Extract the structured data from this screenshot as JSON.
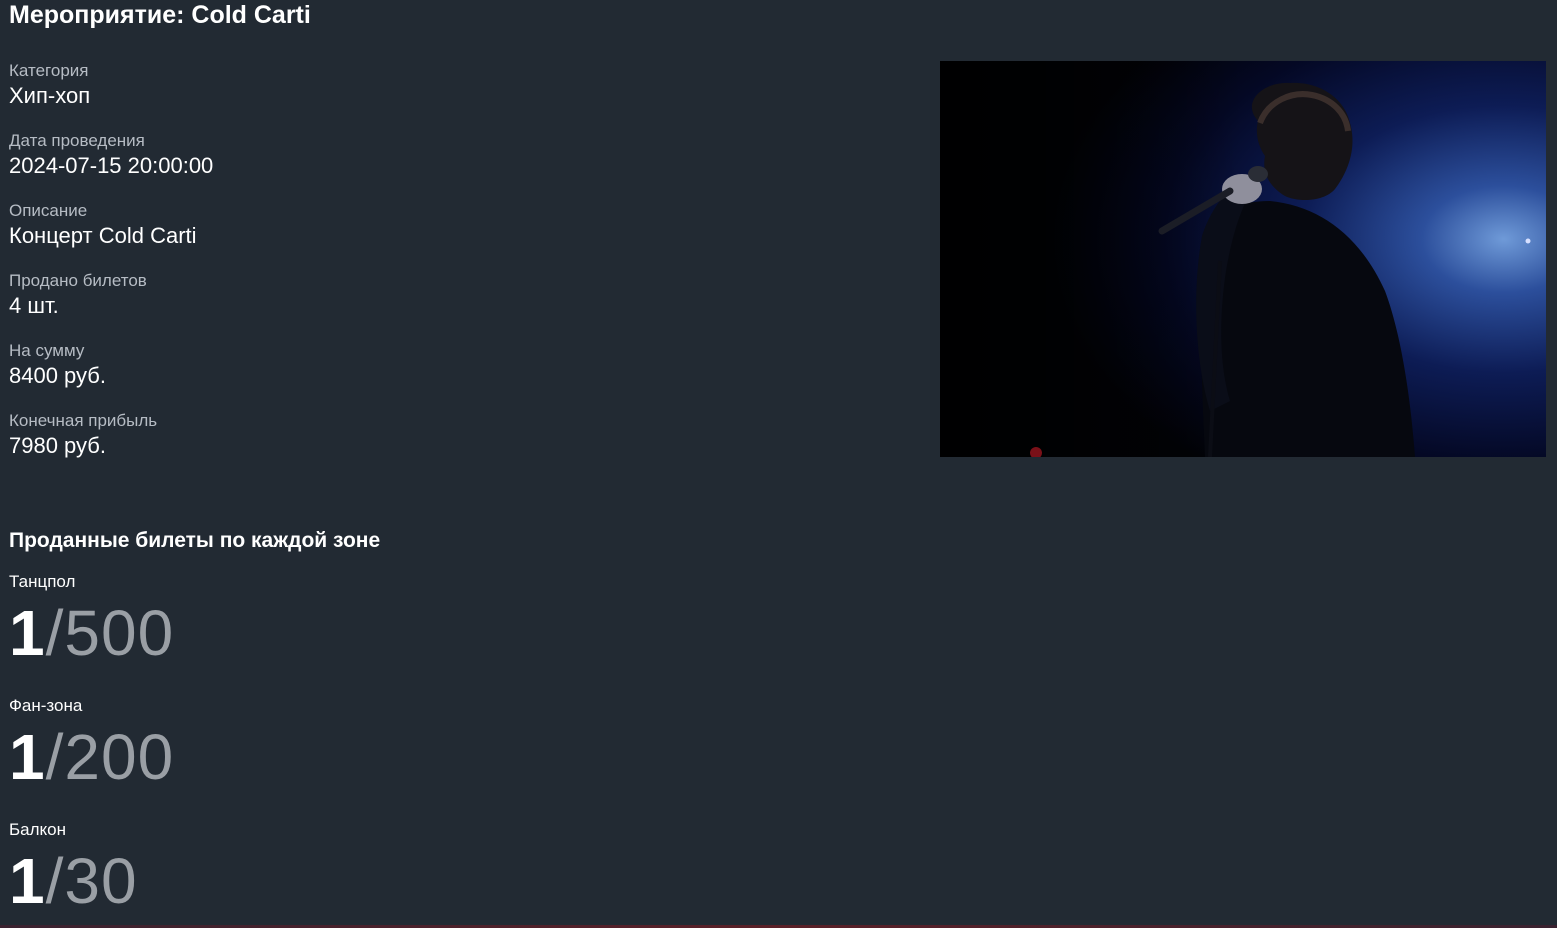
{
  "event": {
    "title": "Мероприятие: Cold Carti"
  },
  "details": [
    {
      "label": "Категория",
      "value": "Хип-хоп"
    },
    {
      "label": "Дата проведения",
      "value": "2024-07-15 20:00:00"
    },
    {
      "label": "Описание",
      "value": "Концерт Cold Carti"
    },
    {
      "label": "Продано билетов",
      "value": "4 шт."
    },
    {
      "label": "На сумму",
      "value": "8400 руб."
    },
    {
      "label": "Конечная прибыль",
      "value": "7980 руб."
    }
  ],
  "zones_heading": "Проданные билеты по каждой зоне",
  "zones": [
    {
      "name": "Танцпол",
      "sold": "1",
      "sep": "/",
      "total": "500"
    },
    {
      "name": "Фан-зона",
      "sold": "1",
      "sep": "/",
      "total": "200"
    },
    {
      "name": "Балкон",
      "sold": "1",
      "sep": "/",
      "total": "30"
    }
  ]
}
